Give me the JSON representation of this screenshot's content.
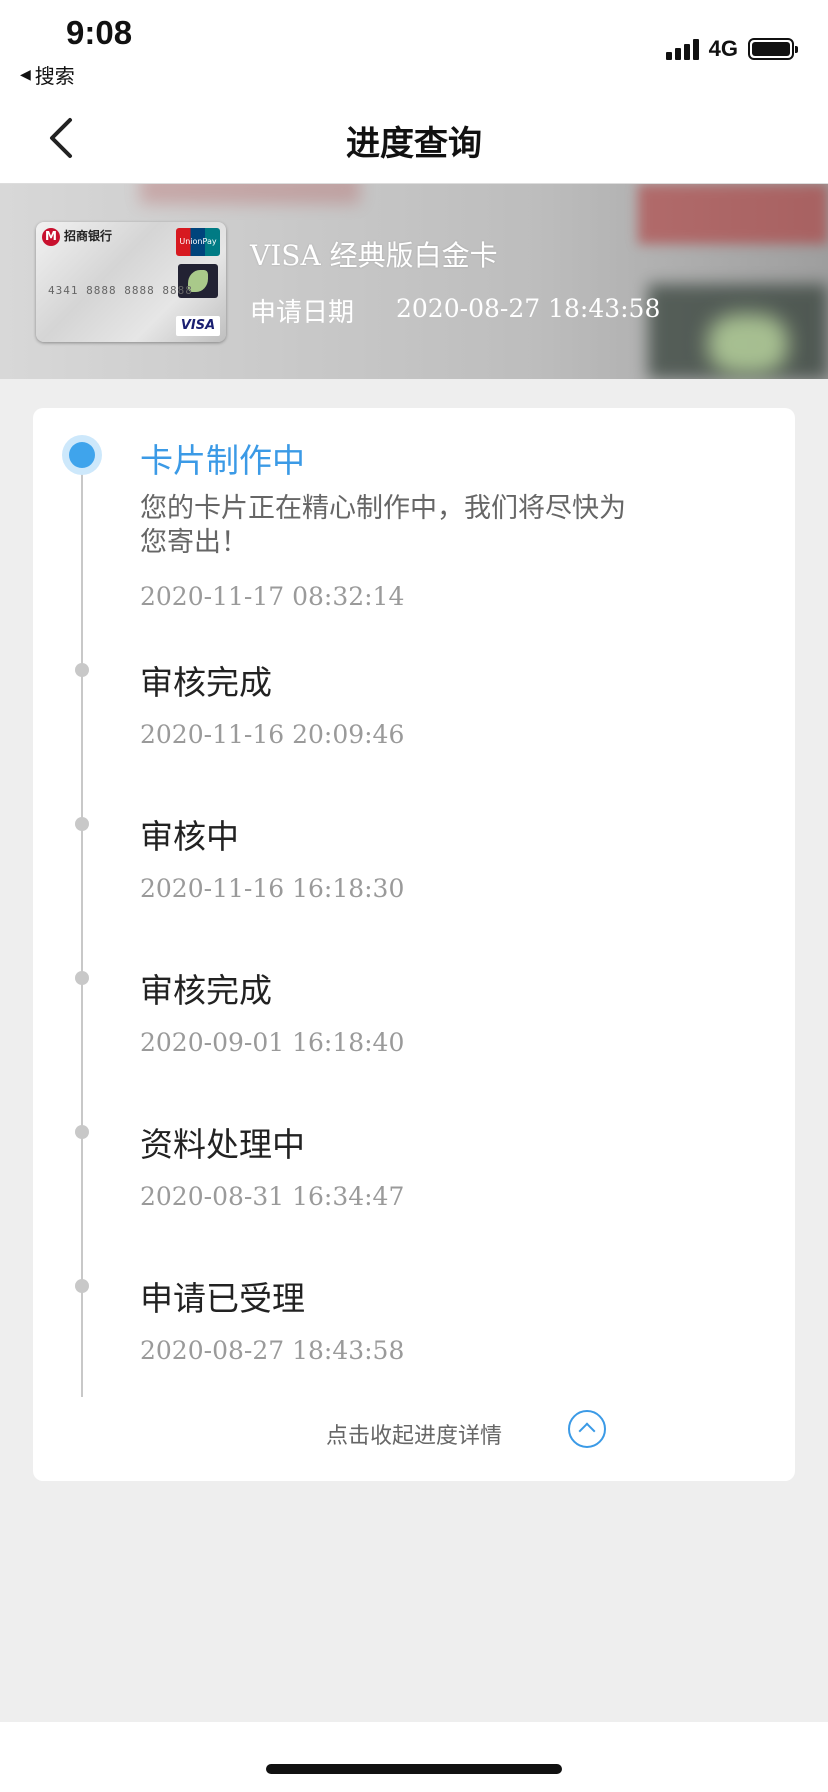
{
  "status_bar": {
    "time": "9:08",
    "back_app": "搜索",
    "network": "4G"
  },
  "nav": {
    "title": "进度查询"
  },
  "card": {
    "bank_name": "招商银行",
    "unionpay_label": "UnionPay 银联",
    "card_number": "4341 8888 8888 8888",
    "network_brand": "VISA",
    "name": "VISA 经典版白金卡",
    "apply_label": "申请日期",
    "apply_date": "2020-08-27 18:43:58"
  },
  "progress": {
    "steps": [
      {
        "title": "卡片制作中",
        "desc": "您的卡片正在精心制作中，我们将尽快为您寄出！",
        "time": "2020-11-17 08:32:14",
        "active": true
      },
      {
        "title": "审核完成",
        "time": "2020-11-16 20:09:46",
        "active": false
      },
      {
        "title": "审核中",
        "time": "2020-11-16 16:18:30",
        "active": false
      },
      {
        "title": "审核完成",
        "time": "2020-09-01 16:18:40",
        "active": false
      },
      {
        "title": "资料处理中",
        "time": "2020-08-31 16:34:47",
        "active": false
      },
      {
        "title": "申请已受理",
        "time": "2020-08-27 18:43:58",
        "active": false
      }
    ],
    "collapse_label": "点击收起进度详情"
  },
  "colors": {
    "accent": "#3b9ae6",
    "background": "#eeeeee"
  }
}
